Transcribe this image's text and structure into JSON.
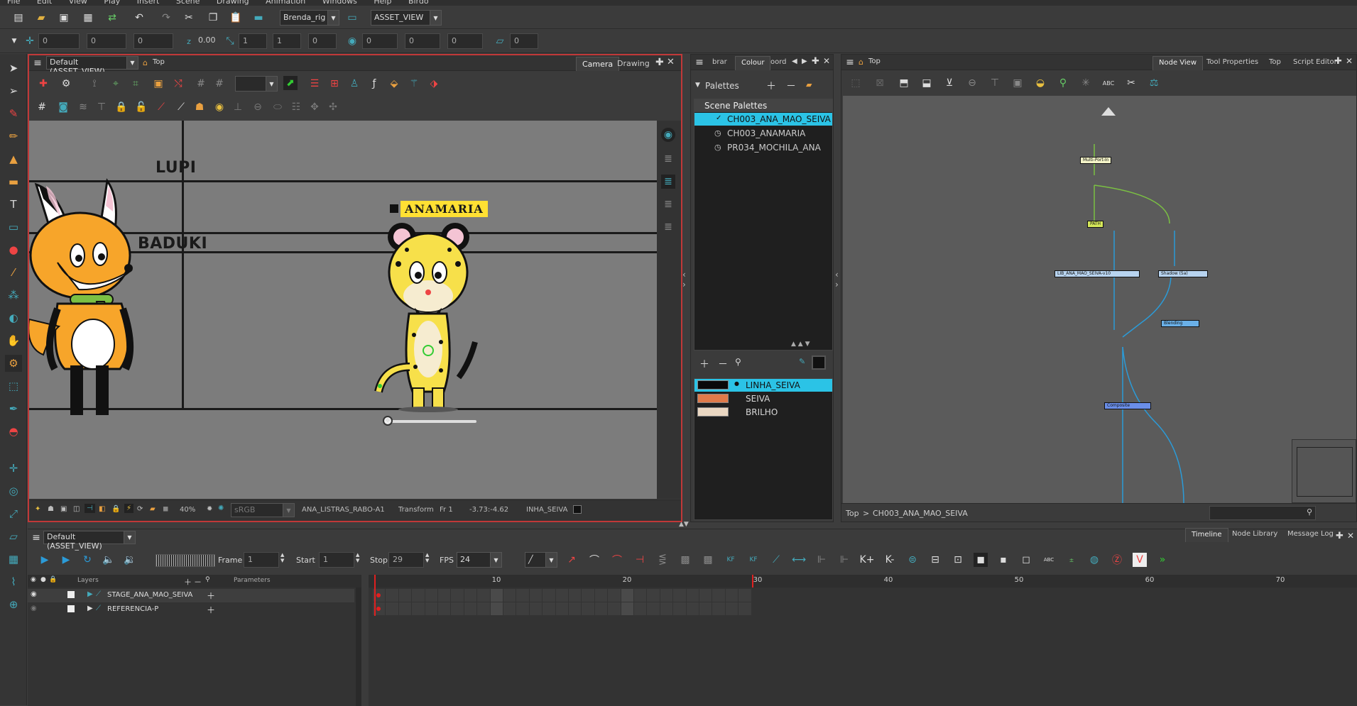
{
  "menu": [
    "File",
    "Edit",
    "View",
    "Play",
    "Insert",
    "Scene",
    "Drawing",
    "Animation",
    "Windows",
    "Help",
    "Birdo"
  ],
  "toolbar": {
    "rig_value": "Brenda_rig",
    "view_value": "ASSET_VIEW",
    "fields": [
      "0",
      "0",
      "0",
      "0.00",
      "1",
      "1",
      "0",
      "0",
      "0",
      "0",
      "0"
    ]
  },
  "camera": {
    "view_selector": "Default (ASSET_VIEW)",
    "top_label": "Top",
    "tabs": [
      "Camera",
      "Drawing"
    ],
    "stage_labels": {
      "lupi": "LUPI",
      "baduki": "BADUKI",
      "anamaria": "ANAMARIA"
    },
    "status": {
      "zoom": "40%",
      "colorspace": "sRGB",
      "drawing": "ANA_LISTRAS_RABO-A1",
      "mode": "Transform",
      "frame": "Fr 1",
      "coords": "-3.73:-4.62",
      "color": "INHA_SEIVA"
    }
  },
  "colour": {
    "tabs": [
      "brar",
      "Colour",
      "oord"
    ],
    "palettes_label": "Palettes",
    "scene_palettes_label": "Scene Palettes",
    "palettes": [
      {
        "name": "CH003_ANA_MAO_SEIVA",
        "selected": true
      },
      {
        "name": "CH003_ANAMARIA",
        "selected": false
      },
      {
        "name": "PR034_MOCHILA_ANA",
        "selected": false
      }
    ],
    "swatches": [
      {
        "name": "LINHA_SEIVA",
        "color": "#0a0a0a",
        "selected": true
      },
      {
        "name": "SEIVA",
        "color": "#e07a4a",
        "selected": false
      },
      {
        "name": "BRILHO",
        "color": "#ead7c2",
        "selected": false
      }
    ]
  },
  "nodeview": {
    "top_label": "Top",
    "tabs": [
      "Node View",
      "Tool Properties",
      "Top",
      "Script Editor"
    ],
    "nodes": {
      "multiport": "Multi-Port-In",
      "path": "PATH",
      "lib": "LIB_ANA_MAO_SEIVA-v10",
      "shadow": "Shadow (5a)",
      "blending": "Blending",
      "composite": "Composite"
    },
    "breadcrumb_root": "Top",
    "breadcrumb_sep": ">",
    "breadcrumb_current": "CH003_ANA_MAO_SEIVA"
  },
  "timeline": {
    "view_selector": "Default (ASSET_VIEW)",
    "tabs": [
      "Timeline",
      "Node Library",
      "Message Log"
    ],
    "frame_label": "Frame",
    "frame_value": "1",
    "start_label": "Start",
    "start_value": "1",
    "stop_label": "Stop",
    "stop_value": "29",
    "fps_label": "FPS",
    "fps_value": "24",
    "layers_label": "Layers",
    "parameters_label": "Parameters",
    "layers": [
      "STAGE_ANA_MAO_SEIVA",
      "REFERENCIA-P"
    ],
    "ticks": [
      "10",
      "20",
      "30",
      "40",
      "50",
      "60",
      "70"
    ],
    "current_frame": 1,
    "stop_frame": 29
  },
  "colors": {
    "accent": "#2bc3e6",
    "active_border": "#c13838",
    "playhead": "#e02020"
  }
}
